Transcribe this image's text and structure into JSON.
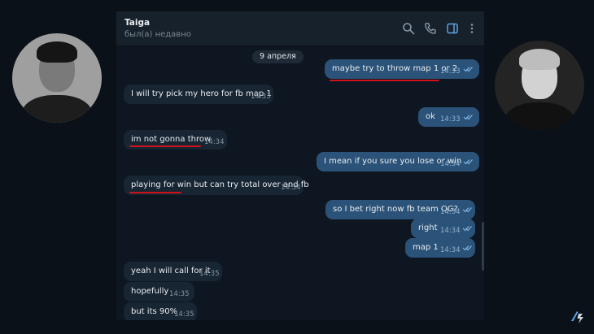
{
  "header": {
    "contact_name": "Taiga",
    "contact_status": "был(а) недавно",
    "icons": [
      "search-icon",
      "phone-icon",
      "sidebar-toggle-icon",
      "more-vertical-icon"
    ]
  },
  "date_separator": "9 апреля",
  "messages": [
    {
      "dir": "out",
      "text": "maybe try to throw map 1 or 2",
      "time": "14:33",
      "read": true,
      "highlighted": true
    },
    {
      "dir": "in",
      "text": "I will try pick my hero for fb map 1",
      "time": "14:33",
      "highlighted": false
    },
    {
      "dir": "out",
      "text": "ok",
      "time": "14:33",
      "read": true,
      "highlighted": false
    },
    {
      "dir": "in",
      "text": "im not gonna throw",
      "time": "14:34",
      "highlighted": true
    },
    {
      "dir": "out",
      "text": "I mean if you sure you lose or win",
      "time": "14:34",
      "read": true,
      "highlighted": false
    },
    {
      "dir": "in",
      "text": "playing for win but can try total over and fb",
      "time": "14:34",
      "highlighted": true
    },
    {
      "dir": "out",
      "text": "so I bet right now fb team OG?",
      "time": "14:34",
      "read": true,
      "highlighted": false
    },
    {
      "dir": "out",
      "text": "right",
      "time": "14:34",
      "read": true,
      "highlighted": false
    },
    {
      "dir": "out",
      "text": "map 1",
      "time": "14:34",
      "read": true,
      "highlighted": false
    },
    {
      "dir": "in",
      "text": "yeah I will call for it",
      "time": "14:35",
      "highlighted": false
    },
    {
      "dir": "in",
      "text": "hopefully",
      "time": "14:35",
      "highlighted": false
    },
    {
      "dir": "in",
      "text": "but its 90%",
      "time": "14:35",
      "highlighted": false
    }
  ],
  "colors": {
    "background": "#0b1118",
    "chat_background": "#0e1621",
    "header_background": "#17212b",
    "incoming_bubble": "#182533",
    "outgoing_bubble": "#2b5278",
    "highlight_underline": "#d0131b"
  }
}
